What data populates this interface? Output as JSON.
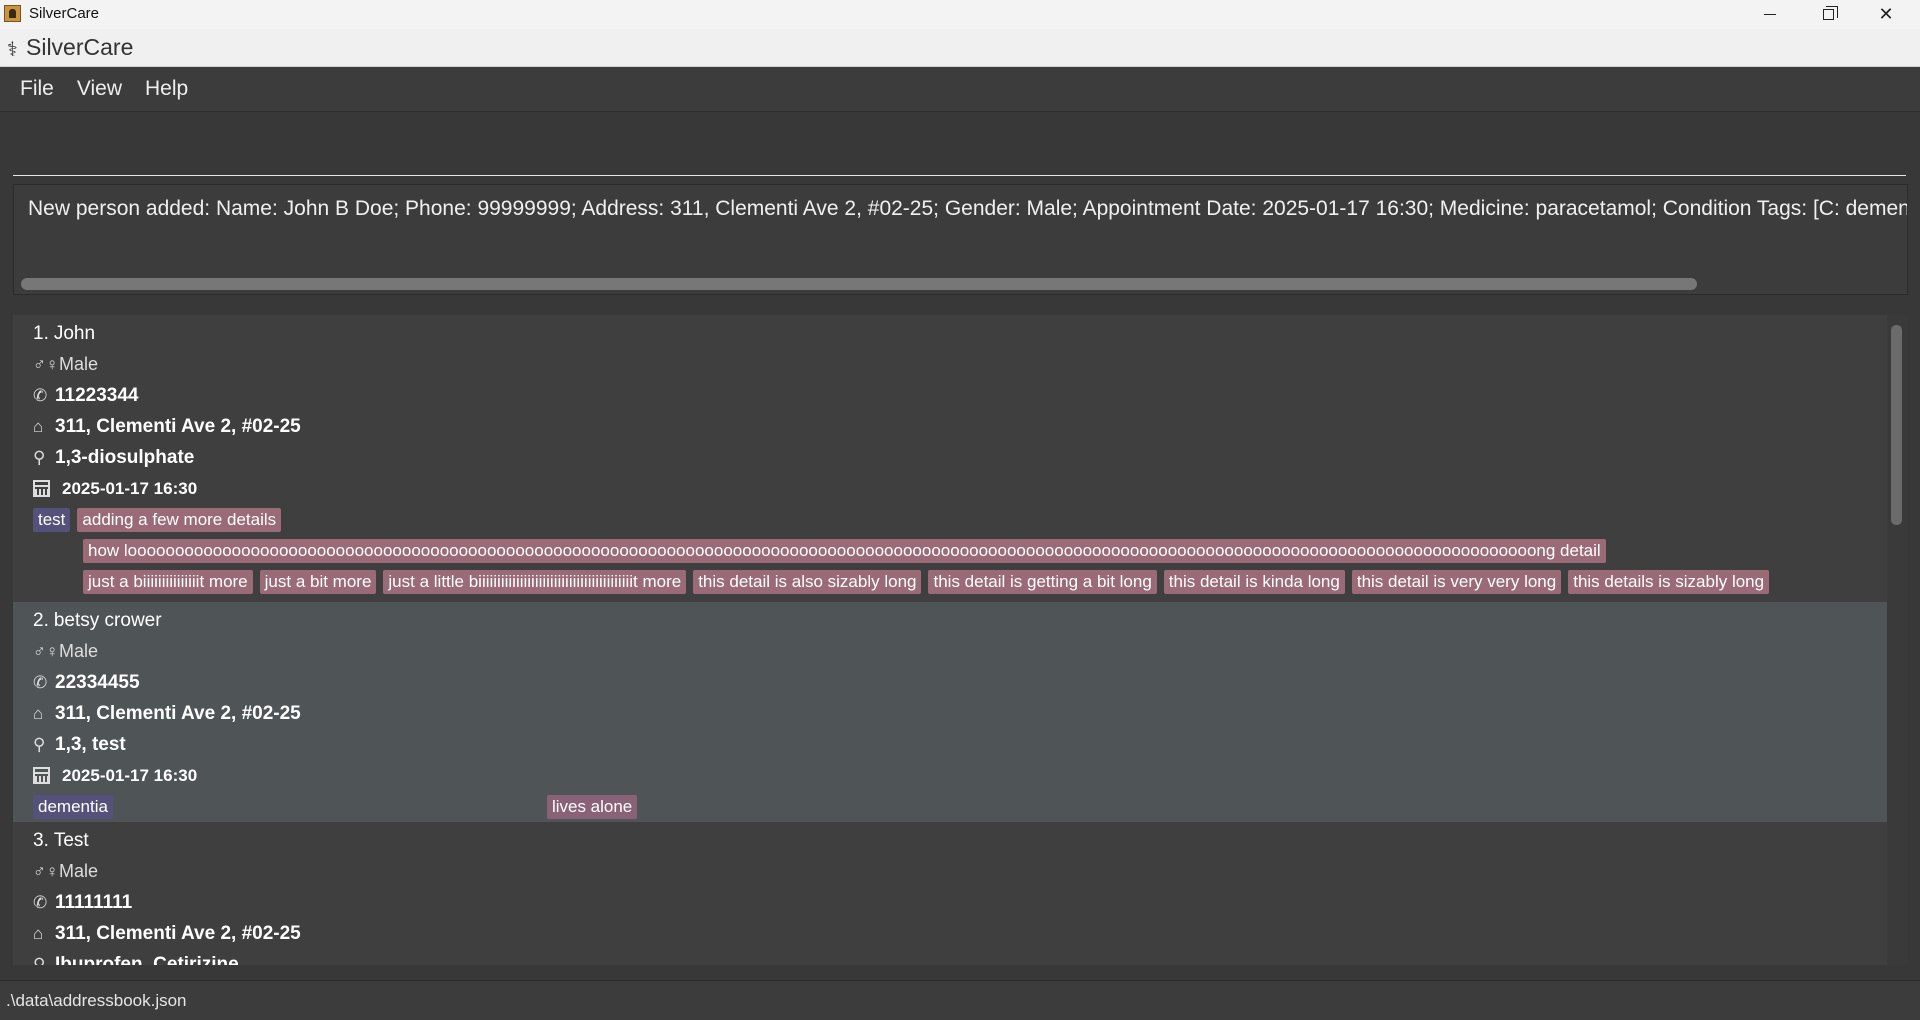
{
  "window": {
    "title": "SilverCare",
    "minimize_icon": "minimize-icon",
    "maximize_icon": "restore-icon",
    "close_icon": "close-icon"
  },
  "header": {
    "app_name": "SilverCare",
    "logo_glyph": "⚕"
  },
  "menu": {
    "file": "File",
    "view": "View",
    "help": "Help"
  },
  "command": {
    "value": "",
    "placeholder": ""
  },
  "result": {
    "text": "New person added: Name: John B Doe; Phone: 99999999; Address: 311, Clementi Ave 2, #02-25; Gender: Male; Appointment Date: 2025-01-17 16:30; Medicine: paracetamol; Condition Tags: [C: dementia]; Detail Tags: [D: lives alone]"
  },
  "icons": {
    "gender": "♂♀",
    "phone": "✆",
    "address": "⌂",
    "medicine": "⚲"
  },
  "persons": [
    {
      "index": "1.",
      "name": "John",
      "gender": "Male",
      "phone": "11223344",
      "address": "311, Clementi Ave 2, #02-25",
      "medicine": "1,3-diosulphate",
      "appointment": "2025-01-17 16:30",
      "condition_tags": [
        "test"
      ],
      "detail_tags_line1": [
        "adding a few more details"
      ],
      "detail_tags_line2": [
        "how looooooooooooooooooooooooooooooooooooooooooooooooooooooooooooooooooooooooooooooooooooooooooooooooooooooooooooooooooooooooooooooooooooooooooooooooooooong detail"
      ],
      "detail_tags_line3": [
        "just a biiiiiiiiiiiiiiit more",
        "just a bit more",
        "just a little biiiiiiiiiiiiiiiiiiiiiiiiiiiiiiiiiiiiiiiiit more",
        "this detail is also sizably long",
        "this detail is getting a bit long",
        "this detail is kinda long",
        "this detail is very very long",
        "this details is sizably long"
      ]
    },
    {
      "index": "2.",
      "name": "betsy crower",
      "gender": "Male",
      "phone": "22334455",
      "address": "311, Clementi Ave 2, #02-25",
      "medicine": "1,3, test",
      "appointment": "2025-01-17 16:30",
      "condition_tags": [
        "dementia"
      ],
      "detail_tags_line1": [
        "lives alone"
      ]
    },
    {
      "index": "3.",
      "name": "Test",
      "gender": "Male",
      "phone": "11111111",
      "address": "311, Clementi Ave 2, #02-25",
      "medicine": "Ibuprofen, Cetirizine"
    }
  ],
  "status": {
    "path": ".\\data\\addressbook.json"
  }
}
